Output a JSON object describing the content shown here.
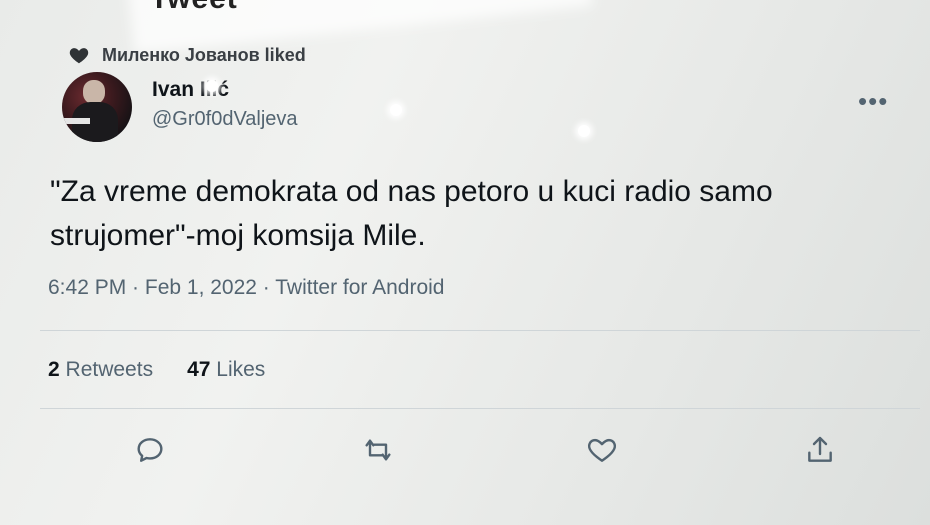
{
  "header": {
    "title": "Tweet"
  },
  "social_context": {
    "text": "Миленко Јованов liked",
    "icon": "heart-filled-icon"
  },
  "author": {
    "name": "Ivan Ilić",
    "handle": "@Gr0f0dValjeva"
  },
  "tweet": {
    "text": "\"Za vreme demokrata od nas petoro u kuci radio samo strujomer\"-moj komsija Mile.",
    "timestamp": "6:42 PM · Feb 1, 2022 · Twitter for Android"
  },
  "stats": {
    "retweets_count": "2",
    "retweets_label": "Retweets",
    "likes_count": "47",
    "likes_label": "Likes"
  },
  "actions": [
    "reply-icon",
    "retweet-icon",
    "like-icon",
    "share-icon"
  ],
  "colors": {
    "text": "#0f1419",
    "secondary": "#536471"
  }
}
